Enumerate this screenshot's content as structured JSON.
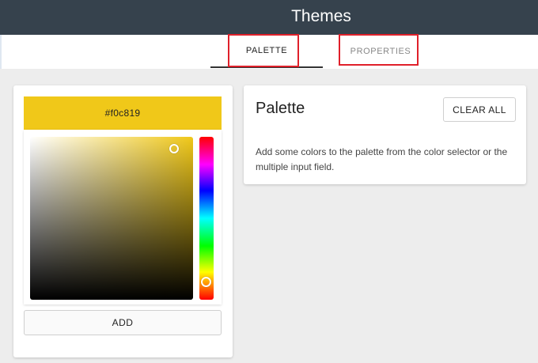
{
  "header": {
    "title": "Themes"
  },
  "tabs": [
    {
      "label": "PALETTE",
      "active": true
    },
    {
      "label": "PROPERTIES",
      "active": false
    }
  ],
  "color_picker": {
    "hex_value": "#f0c819",
    "selected_color": "#f0c819",
    "add_label": "ADD"
  },
  "palette": {
    "title": "Palette",
    "clear_label": "CLEAR ALL",
    "description": "Add some colors to the palette from the color selector or the multiple input field."
  },
  "colors": {
    "header_bg": "#36424d",
    "highlight_red": "#e0202a",
    "page_bg": "#ededed"
  }
}
